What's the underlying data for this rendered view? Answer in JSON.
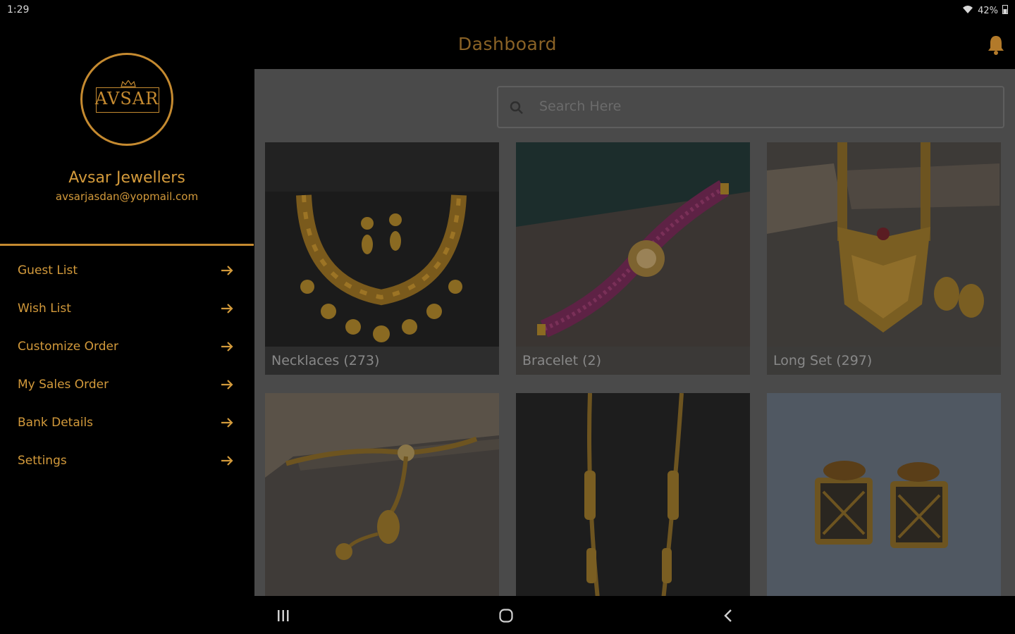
{
  "status": {
    "time": "1:29",
    "battery": "42%"
  },
  "header": {
    "title": "Dashboard"
  },
  "search": {
    "placeholder": "Search Here"
  },
  "drawer": {
    "logo_text": "AVSAR",
    "user_name": "Avsar Jewellers",
    "user_email": "avsarjasdan@yopmail.com",
    "menu": [
      {
        "label": "Guest List"
      },
      {
        "label": "Wish List"
      },
      {
        "label": "Customize Order"
      },
      {
        "label": "My Sales Order"
      },
      {
        "label": "Bank Details"
      },
      {
        "label": "Settings"
      }
    ]
  },
  "categories": [
    {
      "label": "Necklaces (273)"
    },
    {
      "label": "Bracelet (2)"
    },
    {
      "label": "Long Set (297)"
    },
    {
      "label": ""
    },
    {
      "label": ""
    },
    {
      "label": ""
    }
  ],
  "icons": {
    "bell": "bell-icon",
    "search": "search-icon",
    "arrow": "arrow-right-icon",
    "recent": "recent-apps-icon",
    "home": "home-icon",
    "back": "back-icon"
  },
  "colors": {
    "accent": "#c58a30",
    "title": "#8a6226",
    "overlay": "#4a4a4a"
  }
}
